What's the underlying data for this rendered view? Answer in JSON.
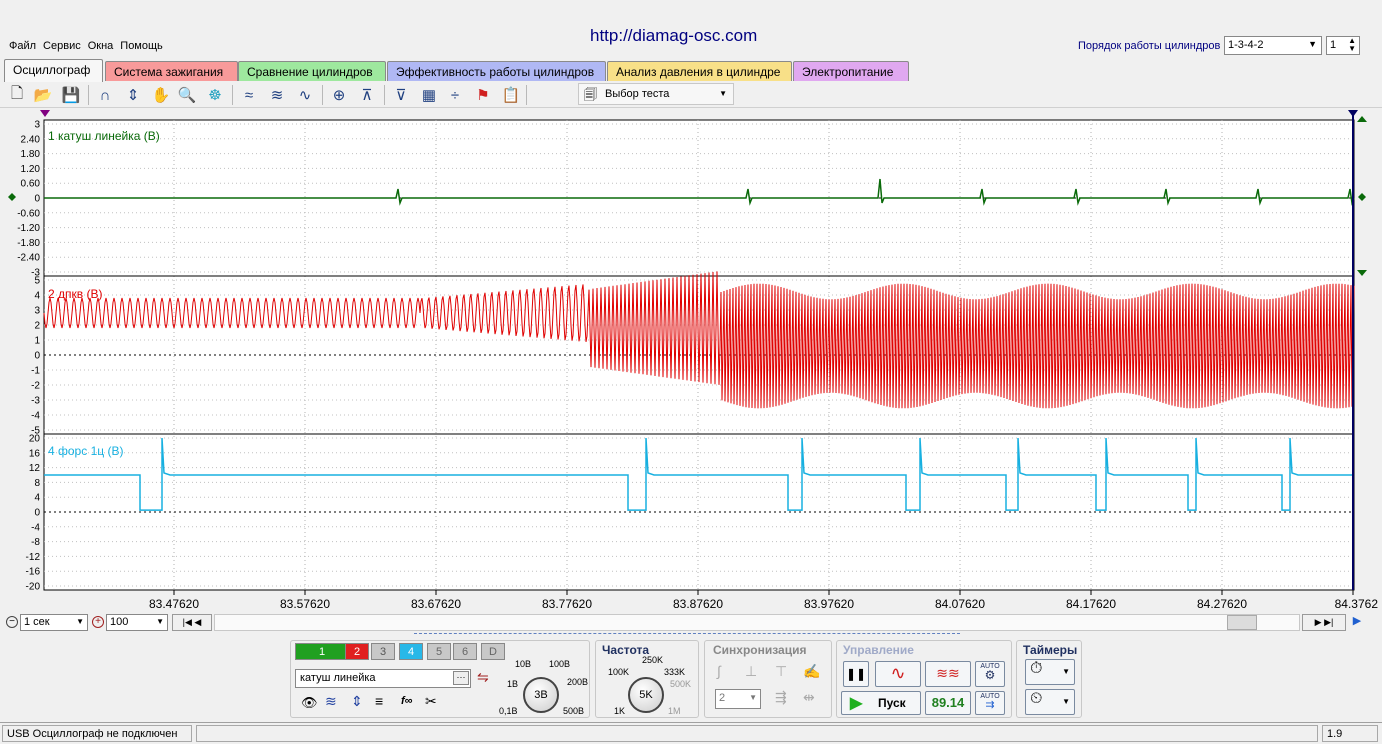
{
  "site_url": "http://diamag-osc.com",
  "menu": [
    "Файл",
    "Сервис",
    "Окна",
    "Помощь"
  ],
  "cyl_order": {
    "label": "Порядок работы цилиндров",
    "value": "1-3-4-2",
    "spin": "1"
  },
  "tabs": [
    {
      "label": "Осциллограф",
      "color": "#f7f7f7"
    },
    {
      "label": "Система зажигания",
      "color": "#f89a9a"
    },
    {
      "label": "Сравнение цилиндров",
      "color": "#9ee89e"
    },
    {
      "label": "Эффективность работы цилиндров",
      "color": "#b0b8f4"
    },
    {
      "label": "Анализ давления в цилиндре",
      "color": "#f8e088"
    },
    {
      "label": "Электропитание",
      "color": "#e0a8f0"
    }
  ],
  "test_select": "Выбор теста",
  "channels": [
    {
      "label": "1 катуш линейка (В)",
      "color": "#0a6a0a",
      "ticks": [
        "3",
        "2.40",
        "1.80",
        "1.20",
        "0.60",
        "0",
        "-0.60",
        "-1.20",
        "-1.80",
        "-2.40",
        "-3"
      ]
    },
    {
      "label": "2 дпкв (В)",
      "color": "#e00000",
      "ticks": [
        "5",
        "4",
        "3",
        "2",
        "1",
        "0",
        "-1",
        "-2",
        "-3",
        "-4",
        "-5"
      ]
    },
    {
      "label": "4 форс 1ц (В)",
      "color": "#18b0e0",
      "ticks": [
        "20",
        "16",
        "12",
        "8",
        "4",
        "0",
        "-4",
        "-8",
        "-12",
        "-16",
        "-20"
      ]
    }
  ],
  "x_ticks": [
    "83.47620",
    "83.57620",
    "83.67620",
    "83.77620",
    "83.87620",
    "83.97620",
    "84.07620",
    "84.17620",
    "84.27620",
    "84.3762"
  ],
  "timebase": {
    "value": "1 сек",
    "zoom": "100"
  },
  "channel_panel": {
    "buttons": [
      "1",
      "2",
      "3",
      "4",
      "5",
      "6",
      "D"
    ],
    "name": "катуш линейка",
    "knob_value": "3В",
    "scale_labels": [
      "10В",
      "100В",
      "1В",
      "200В",
      "0,1В",
      "500В"
    ]
  },
  "frequency": {
    "title": "Частота",
    "labels": [
      "250K",
      "100K",
      "333K",
      "500K",
      "1K",
      "1M"
    ],
    "value": "5K"
  },
  "sync": {
    "title": "Синхронизация",
    "value": "2"
  },
  "control": {
    "title": "Управление",
    "start": "Пуск",
    "value": "89.14",
    "auto": "AUTO"
  },
  "timers": {
    "title": "Таймеры"
  },
  "status": {
    "left": "USB Осциллограф не подключен",
    "right": "1.9"
  }
}
